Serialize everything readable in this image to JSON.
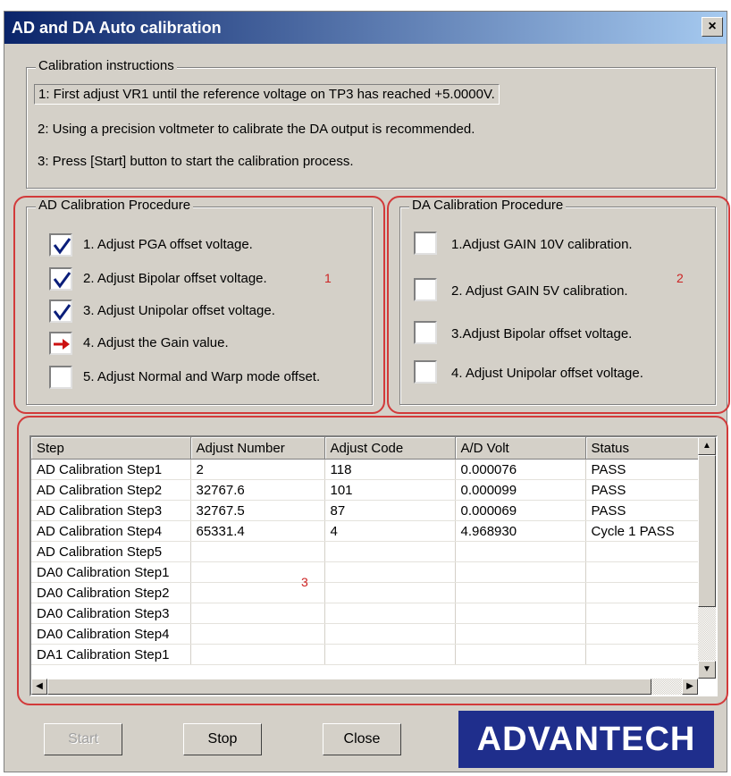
{
  "window": {
    "title": "AD and DA Auto calibration",
    "close_glyph": "×"
  },
  "instructions": {
    "legend": "Calibration instructions",
    "line1": "1: First adjust VR1 until the reference voltage on  TP3 has reached +5.0000V.",
    "line2": "2: Using a precision voltmeter to calibrate the DA output is recommended.",
    "line3": "3:  Press [Start] button to start the calibration process."
  },
  "ad_procedure": {
    "legend": "AD Calibration Procedure",
    "annotation": "1",
    "items": [
      {
        "label": "1. Adjust PGA offset voltage.",
        "state": "checked"
      },
      {
        "label": "2. Adjust Bipolar offset voltage.",
        "state": "checked"
      },
      {
        "label": "3. Adjust Unipolar offset voltage.",
        "state": "checked"
      },
      {
        "label": "4. Adjust the Gain value.",
        "state": "in-progress"
      },
      {
        "label": "5. Adjust Normal and Warp mode offset.",
        "state": "unchecked"
      }
    ]
  },
  "da_procedure": {
    "legend": "DA Calibration Procedure",
    "annotation": "2",
    "items": [
      {
        "label": "1.Adjust GAIN 10V calibration.",
        "state": "unchecked"
      },
      {
        "label": "2. Adjust GAIN 5V calibration.",
        "state": "unchecked"
      },
      {
        "label": "3.Adjust Bipolar offset voltage.",
        "state": "unchecked"
      },
      {
        "label": "4. Adjust Unipolar offset voltage.",
        "state": "unchecked"
      }
    ]
  },
  "table": {
    "annotation": "3",
    "columns": [
      "Step",
      "Adjust Number",
      "Adjust Code",
      "A/D Volt",
      "Status"
    ],
    "rows": [
      [
        "AD Calibration Step1",
        "2",
        "118",
        "0.000076",
        "PASS"
      ],
      [
        "AD Calibration Step2",
        "32767.6",
        "101",
        "0.000099",
        "PASS"
      ],
      [
        "AD Calibration Step3",
        "32767.5",
        "87",
        "0.000069",
        "PASS"
      ],
      [
        "AD Calibration Step4",
        "65331.4",
        "4",
        "4.968930",
        "Cycle 1 PASS"
      ],
      [
        "AD Calibration Step5",
        "",
        "",
        "",
        ""
      ],
      [
        "DA0 Calibration Step1",
        "",
        "",
        "",
        ""
      ],
      [
        "DA0 Calibration Step2",
        "",
        "",
        "",
        ""
      ],
      [
        "DA0 Calibration Step3",
        "",
        "",
        "",
        ""
      ],
      [
        "DA0 Calibration Step4",
        "",
        "",
        "",
        ""
      ],
      [
        "DA1 Calibration Step1",
        "",
        "",
        "",
        ""
      ]
    ]
  },
  "buttons": {
    "start": "Start",
    "stop": "Stop",
    "close": "Close"
  },
  "logo": {
    "text": "ADVANTECH"
  },
  "colors": {
    "annotation": "#cc2222",
    "check": "#0a1e7a",
    "arrow": "#cc1111",
    "logo_bg": "#1f2e8c"
  }
}
